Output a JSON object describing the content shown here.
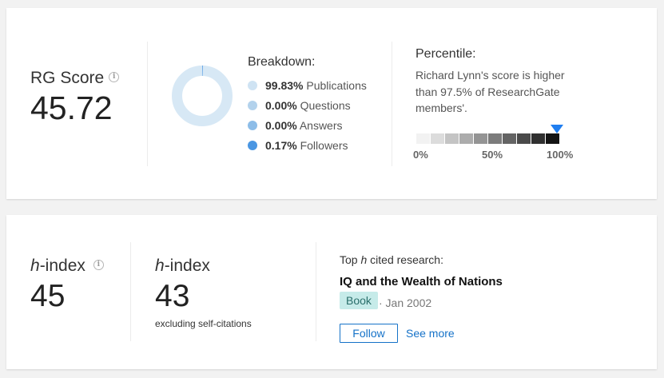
{
  "rg_score": {
    "label": "RG Score",
    "value": "45.72",
    "info_icon": "i"
  },
  "breakdown": {
    "title": "Breakdown:",
    "items": [
      {
        "pct": "99.83%",
        "label": " Publications",
        "color": "#cfe3f3"
      },
      {
        "pct": "0.00%",
        "label": " Questions",
        "color": "#b3d2ec"
      },
      {
        "pct": "0.00%",
        "label": " Answers",
        "color": "#8dbde8"
      },
      {
        "pct": "0.17%",
        "label": " Followers",
        "color": "#4a96e2"
      }
    ],
    "donut_colors": {
      "publications": "#d7e8f5",
      "followers": "#4a96e2"
    }
  },
  "percentile": {
    "title": "Percentile:",
    "text": "Richard Lynn's score is higher than 97.5% of ResearchGate members'.",
    "value": 97.5,
    "ticks": [
      "0%",
      "50%",
      "100%"
    ],
    "segments": [
      "#f2f2f2",
      "#dcdcdc",
      "#c4c4c4",
      "#acacac",
      "#949494",
      "#7c7c7c",
      "#646464",
      "#4a4a4a",
      "#303030",
      "#141414"
    ],
    "marker_color": "#1f7ef0"
  },
  "h_index": {
    "label_italic": "h",
    "label_rest": "-index",
    "value": "45",
    "info_icon": "i"
  },
  "h_index_excl": {
    "label_italic": "h",
    "label_rest": "-index",
    "value": "43",
    "sub": "excluding self-citations"
  },
  "top_research": {
    "title_before": "Top ",
    "title_italic": "h",
    "title_after": " cited research:",
    "title": "IQ and the Wealth of Nations",
    "type": "Book",
    "date": "· Jan 2002",
    "follow_label": "Follow",
    "see_more_label": "See more"
  }
}
